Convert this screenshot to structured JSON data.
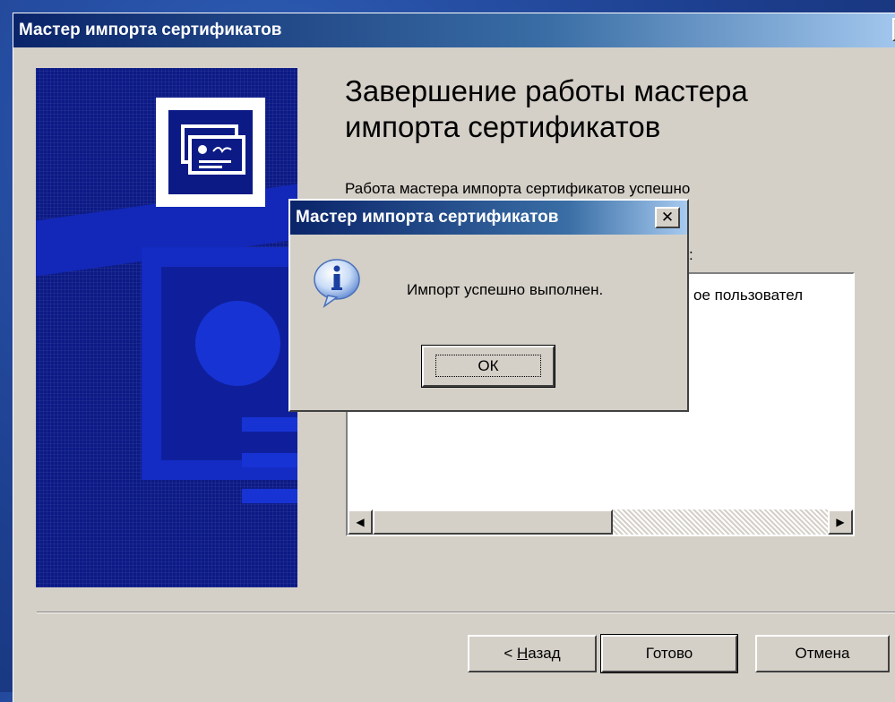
{
  "wizard": {
    "title": "Мастер импорта сертификатов",
    "heading": "Завершение работы мастера импорта сертификатов",
    "description": "Работа мастера импорта сертификатов успешно",
    "partial_label": ":",
    "list_item": "ое пользовател",
    "buttons": {
      "back_prefix": "< ",
      "back_underlined": "Н",
      "back_rest": "азад",
      "finish": "Готово",
      "cancel": "Отмена"
    },
    "close_glyph": "✕"
  },
  "message_box": {
    "title": "Мастер импорта сертификатов",
    "text": "Импорт успешно выполнен.",
    "ok_label": "ОК",
    "close_glyph": "✕",
    "icon": "info-icon"
  },
  "colors": {
    "titlebar_start": "#0a246a",
    "titlebar_end": "#a6caf0",
    "dialog_face": "#d4d0c8",
    "banner": "#0c1a86"
  }
}
